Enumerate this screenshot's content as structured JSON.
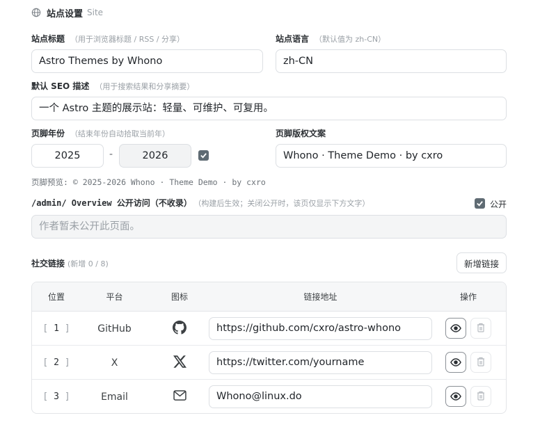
{
  "site_section": {
    "title": "站点设置",
    "subtitle": "Site"
  },
  "site_title": {
    "label": "站点标题",
    "hint": "（用于浏览器标题 / RSS / 分享）",
    "value": "Astro Themes by Whono"
  },
  "site_lang": {
    "label": "站点语言",
    "hint": "（默认值为 zh-CN）",
    "value": "zh-CN"
  },
  "seo": {
    "label": "默认 SEO 描述",
    "hint": "（用于搜索结果和分享摘要）",
    "value": "一个 Astro 主题的展示站：轻量、可维护、可复用。"
  },
  "footer_year": {
    "label": "页脚年份",
    "hint": "（结束年份自动拾取当前年）",
    "start": "2025",
    "separator": "-",
    "end": "2026",
    "checked": true
  },
  "footer_copy": {
    "label": "页脚版权文案",
    "value": "Whono · Theme Demo · by cxro"
  },
  "footer_preview": "页脚预览: © 2025-2026 Whono · Theme Demo · by cxro",
  "admin_overview": {
    "label": "/admin/ Overview 公开访问（不收录）",
    "hint": "（构建后生效；关闭公开时，该页仅显示下方文字）",
    "public_label": "公开",
    "public_checked": true,
    "placeholder": "作者暂未公开此页面。"
  },
  "social": {
    "label": "社交链接",
    "hint": "(新增 0 / 8)",
    "add_button": "新增链接",
    "columns": [
      "位置",
      "平台",
      "图标",
      "链接地址",
      "操作"
    ],
    "rows": [
      {
        "position": "1",
        "platform": "GitHub",
        "icon": "github-icon",
        "url": "https://github.com/cxro/astro-whono"
      },
      {
        "position": "2",
        "platform": "X",
        "icon": "x-icon",
        "url": "https://twitter.com/yourname"
      },
      {
        "position": "3",
        "platform": "Email",
        "icon": "mail-icon",
        "url": "Whono@linux.do"
      }
    ]
  },
  "colors": {
    "checkbox": "#5f6b73",
    "border": "#dcdfe3",
    "muted": "#9aa0a6"
  }
}
